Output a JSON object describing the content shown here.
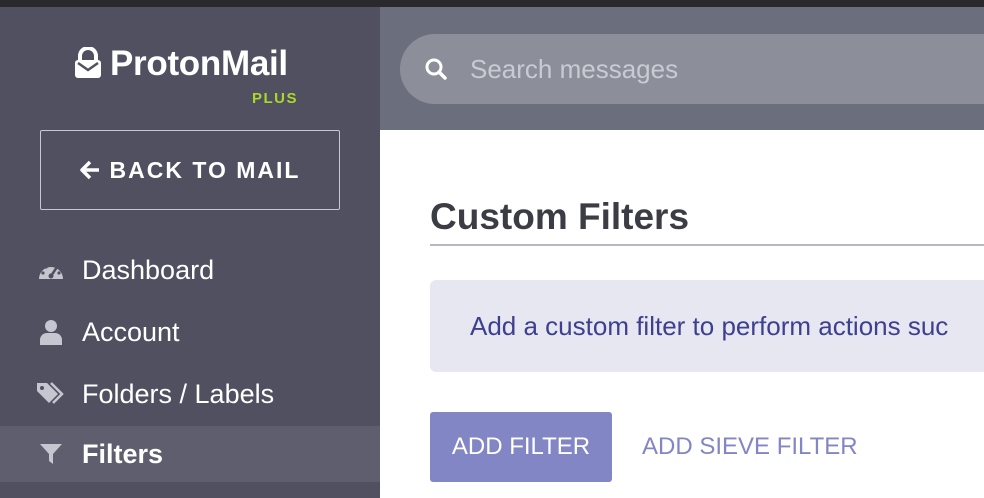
{
  "sidebar": {
    "brand": "ProtonMail",
    "plan": "PLUS",
    "back_label": "BACK TO MAIL",
    "items": [
      {
        "label": "Dashboard",
        "icon": "dashboard-icon"
      },
      {
        "label": "Account",
        "icon": "user-icon"
      },
      {
        "label": "Folders / Labels",
        "icon": "tags-icon"
      },
      {
        "label": "Filters",
        "icon": "filter-icon",
        "active": true
      }
    ]
  },
  "header": {
    "search_placeholder": "Search messages"
  },
  "main": {
    "title": "Custom Filters",
    "info_text": "Add a custom filter to perform actions suc",
    "add_filter_label": "ADD FILTER",
    "add_sieve_label": "ADD SIEVE FILTER"
  },
  "colors": {
    "sidebar_bg": "#505061",
    "header_bg": "#6b6e7c",
    "accent": "#8386c5",
    "plan_green": "#a9d82b",
    "info_bg": "#e6e7f1",
    "info_text": "#3d3f8f"
  }
}
